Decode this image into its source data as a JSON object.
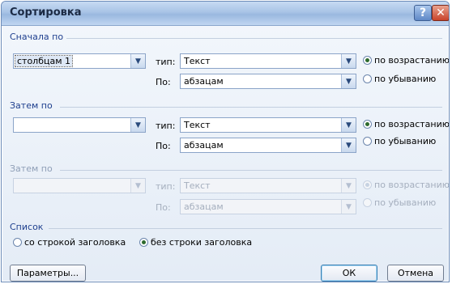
{
  "window": {
    "title": "Сортировка",
    "help_icon": "?",
    "close_icon": "✕"
  },
  "sort_levels": [
    {
      "group_label": "Сначала по",
      "column": "столбцам 1",
      "type_label": "тип:",
      "type_value": "Текст",
      "by_label": "По:",
      "by_value": "абзацам",
      "ascending": "по возрастанию",
      "descending": "по убыванию",
      "selected": "ascending",
      "enabled": true
    },
    {
      "group_label": "Затем по",
      "column": "",
      "type_label": "тип:",
      "type_value": "Текст",
      "by_label": "По:",
      "by_value": "абзацам",
      "ascending": "по возрастанию",
      "descending": "по убыванию",
      "selected": "ascending",
      "enabled": true
    },
    {
      "group_label": "Затем по",
      "column": "",
      "type_label": "тип:",
      "type_value": "Текст",
      "by_label": "По:",
      "by_value": "абзацам",
      "ascending": "по возрастанию",
      "descending": "по убыванию",
      "selected": "ascending",
      "enabled": false
    }
  ],
  "list": {
    "label": "Список",
    "with_header": "со строкой заголовка",
    "without_header": "без строки заголовка",
    "selected": "without_header"
  },
  "buttons": {
    "options": "Параметры...",
    "ok": "ОК",
    "cancel": "Отмена"
  },
  "icons": {
    "dropdown": "chevron-down-icon",
    "help": "help-icon",
    "close": "close-icon"
  },
  "colors": {
    "group_label": "#1e3f8e",
    "close_button": "#c9432a",
    "title_bar": "#a8c3e6"
  }
}
